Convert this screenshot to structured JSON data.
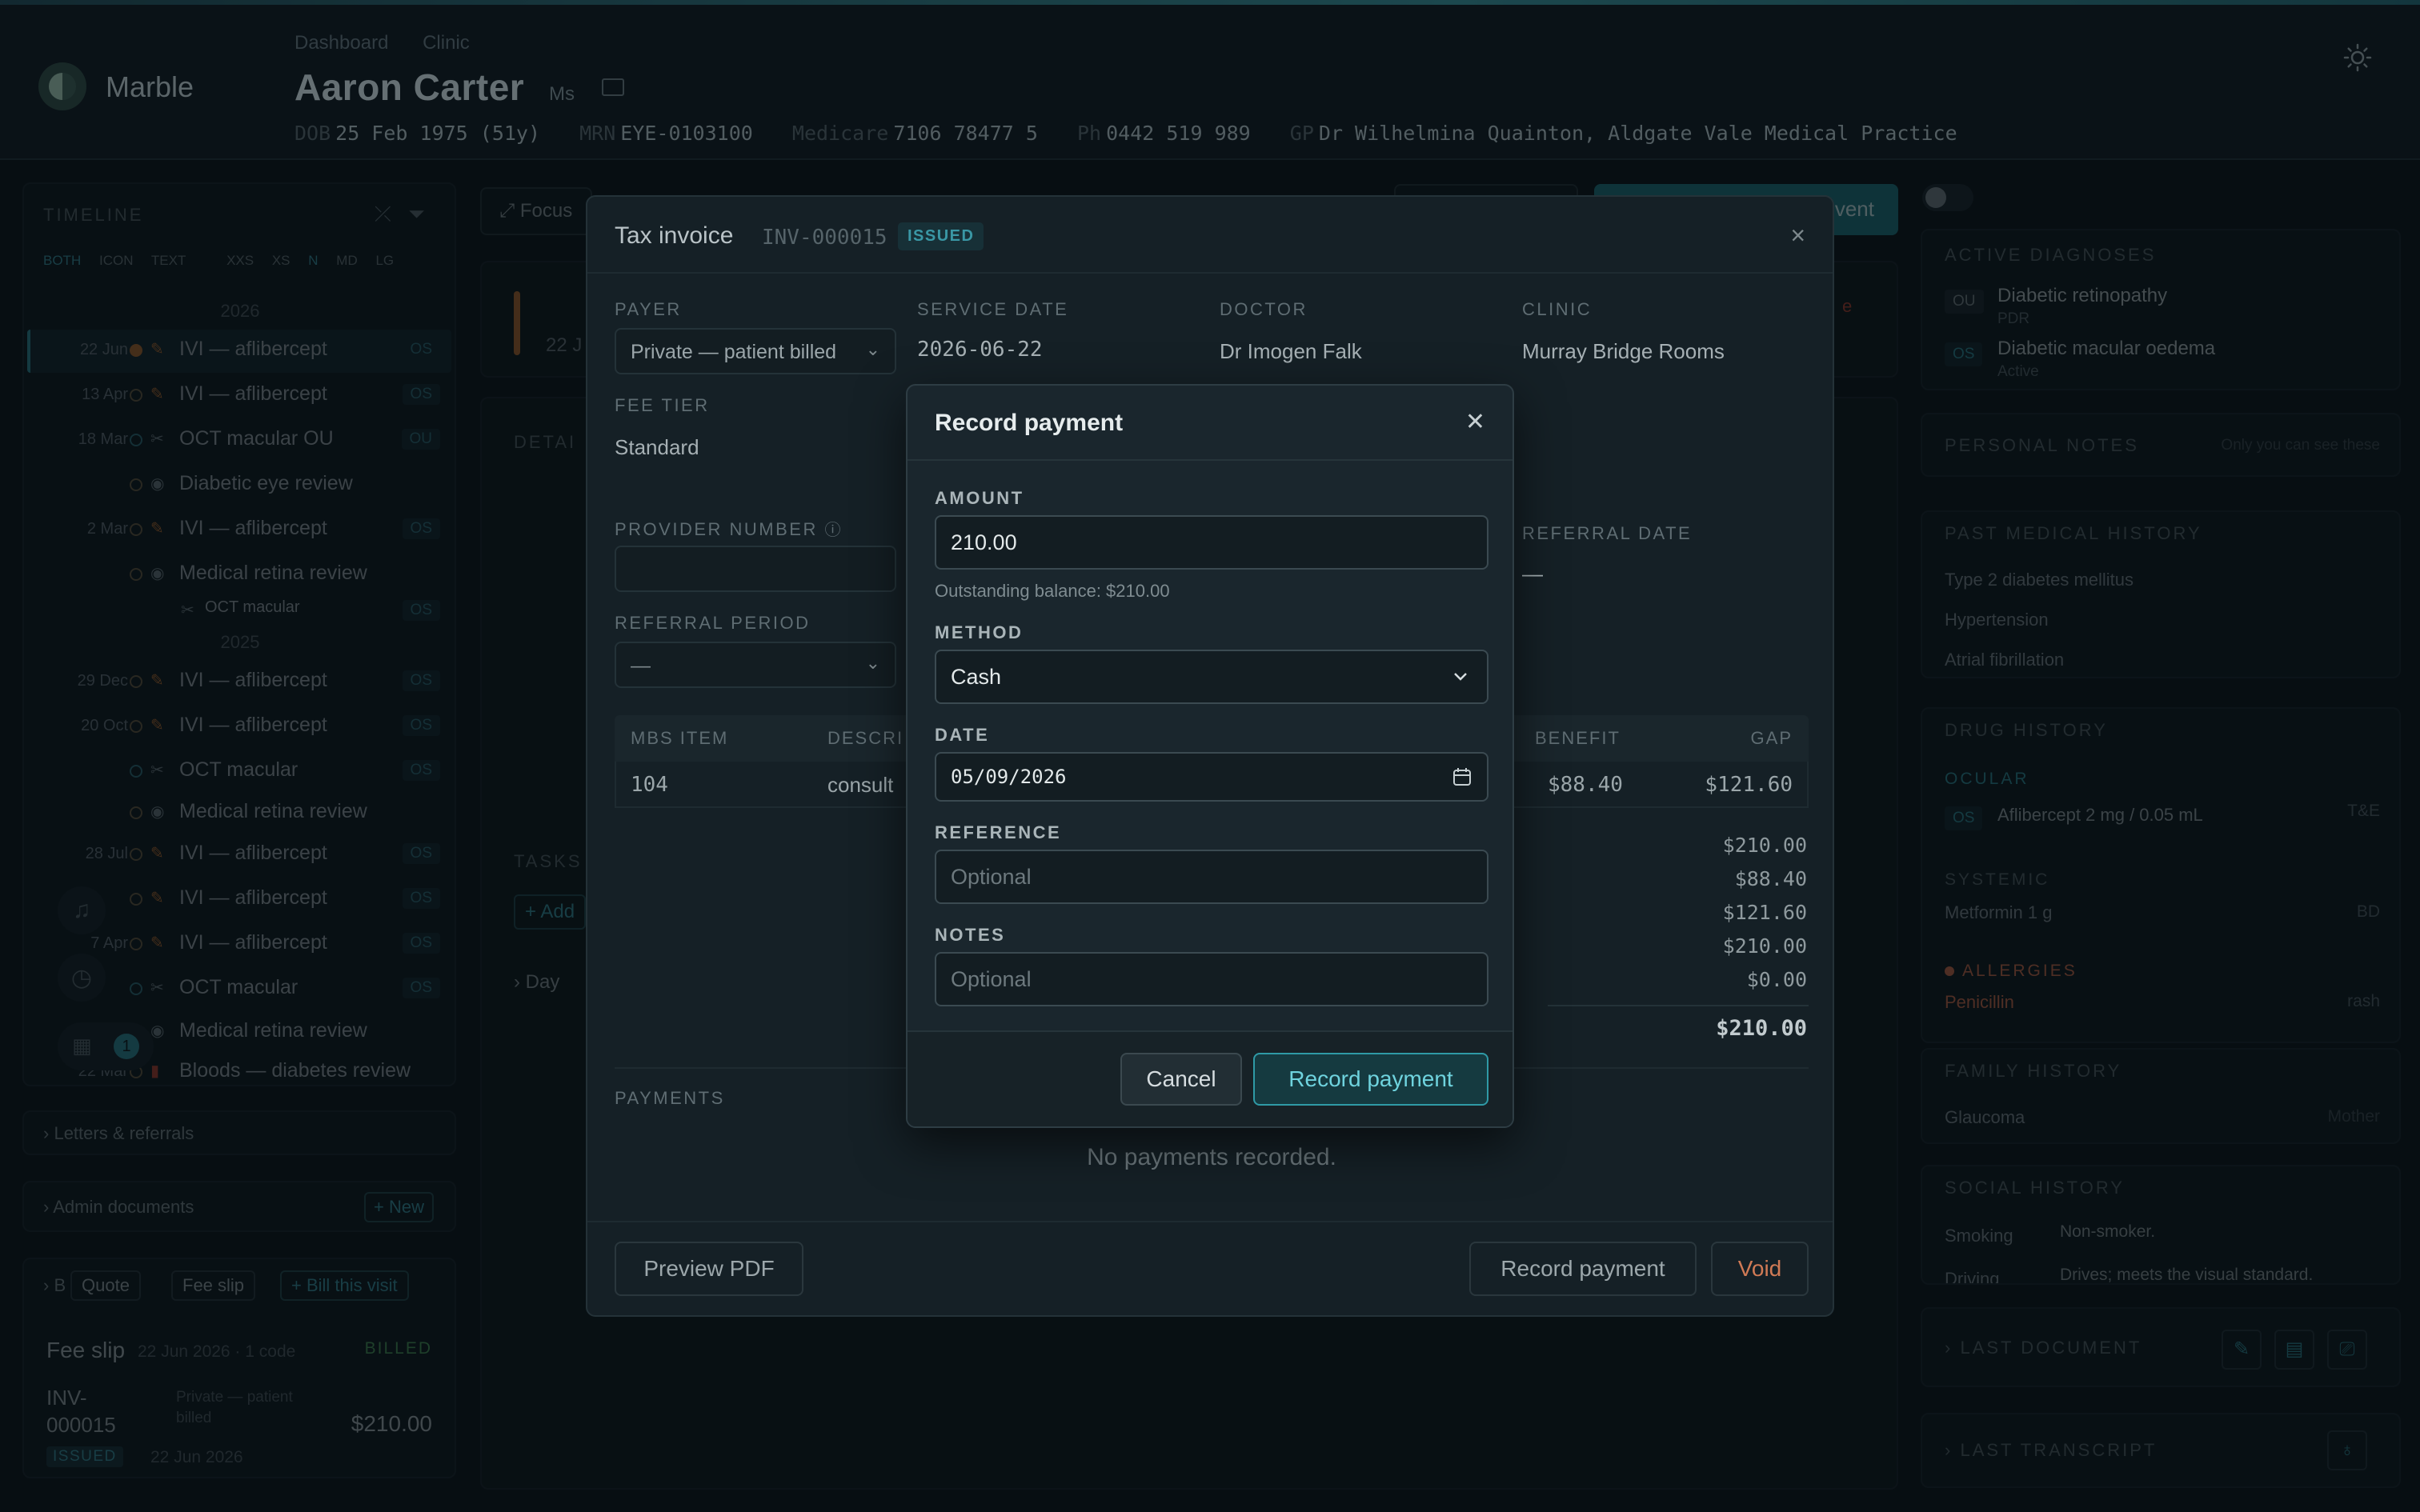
{
  "app": {
    "brand": "Marble"
  },
  "header": {
    "breadcrumbs": [
      "Dashboard",
      "Clinic"
    ],
    "patient_name": "Aaron Carter",
    "patient_title": "Ms",
    "dob_label": "DOB",
    "dob": "25 Feb 1975 (51y)",
    "mrn_label": "MRN",
    "mrn": "EYE-0103100",
    "medicare_label": "Medicare",
    "medicare": "7106 78477 5",
    "ph_label": "Ph",
    "phone": "0442 519 989",
    "gp_label": "GP",
    "gp": "Dr Wilhelmina Quainton, Aldgate Vale Medical Practice"
  },
  "timeline": {
    "title": "TIMELINE",
    "view_tabs": [
      "BOTH",
      "ICON",
      "TEXT"
    ],
    "size_tabs": [
      "XXS",
      "XS",
      "N",
      "MD",
      "LG"
    ],
    "year_2026": "2026",
    "year_2025": "2025",
    "items": [
      {
        "date": "22 Jun",
        "label": "IVI — aflibercept",
        "eye": "OS"
      },
      {
        "date": "13 Apr",
        "label": "IVI — aflibercept",
        "eye": "OS"
      },
      {
        "date": "18 Mar",
        "label": "OCT macular OU",
        "eye": "OU"
      },
      {
        "date": "",
        "label": "Diabetic eye review",
        "eye": ""
      },
      {
        "date": "2 Mar",
        "label": "IVI — aflibercept",
        "eye": "OS"
      },
      {
        "date": "",
        "label": "Medical retina review",
        "eye": ""
      },
      {
        "date": "",
        "label": "OCT macular",
        "eye": "OS"
      },
      {
        "date": "29 Dec",
        "label": "IVI — aflibercept",
        "eye": "OS"
      },
      {
        "date": "20 Oct",
        "label": "IVI — aflibercept",
        "eye": "OS"
      },
      {
        "date": "",
        "label": "OCT macular",
        "eye": "OS"
      },
      {
        "date": "",
        "label": "Medical retina review",
        "eye": ""
      },
      {
        "date": "28 Jul",
        "label": "IVI — aflibercept",
        "eye": "OS"
      },
      {
        "date": "",
        "label": "IVI — aflibercept",
        "eye": "OS"
      },
      {
        "date": "7 Apr",
        "label": "IVI — aflibercept",
        "eye": "OS"
      },
      {
        "date": "",
        "label": "OCT macular",
        "eye": "OS"
      },
      {
        "date": "",
        "label": "Medical retina review",
        "eye": ""
      },
      {
        "date": "22 Mar",
        "label": "Bloods — diabetes review",
        "eye": ""
      }
    ],
    "notif_count": "1"
  },
  "left_sections": {
    "letters": "Letters & referrals",
    "admin": "Admin documents",
    "new_btn": "+ New",
    "quote_btn": "Quote",
    "fee_slip_btn": "Fee slip",
    "bill_btn": "+ Bill this visit",
    "fee_slip_title": "Fee slip",
    "fee_slip_meta": "22 Jun 2026 · 1 code",
    "fee_slip_status": "BILLED",
    "inv_no": "INV-000015",
    "inv_payer": "Private — patient billed",
    "inv_amount": "$210.00",
    "inv_status": "ISSUED",
    "inv_date": "22 Jun 2026"
  },
  "center_bg": {
    "focus": "Focus",
    "record_event_btn": "vent",
    "details": "DETAI",
    "tasks": "TASKS",
    "add": "+ Add",
    "day": "Day"
  },
  "right_panel": {
    "active_dx_title": "ACTIVE DIAGNOSES",
    "dx": [
      {
        "eye": "OU",
        "name": "Diabetic retinopathy",
        "sub": "PDR"
      },
      {
        "eye": "OS",
        "name": "Diabetic macular oedema",
        "sub": "Active"
      }
    ],
    "personal_notes_title": "PERSONAL NOTES",
    "personal_notes_hint": "Only you can see these",
    "pmh_title": "PAST MEDICAL HISTORY",
    "pmh": [
      "Type 2 diabetes mellitus",
      "Hypertension",
      "Atrial fibrillation"
    ],
    "drug_title": "DRUG HISTORY",
    "ocular_label": "OCULAR",
    "ocular_drug_eye": "OS",
    "ocular_drug": "Aflibercept 2 mg / 0.05 mL",
    "ocular_drug_freq": "T&E",
    "systemic_label": "SYSTEMIC",
    "systemic_drug": "Metformin 1 g",
    "systemic_freq": "BD",
    "allergies_label": "ALLERGIES",
    "allergy": "Penicillin",
    "allergy_reaction": "rash",
    "family_title": "FAMILY HISTORY",
    "family_item": "Glaucoma",
    "family_rel": "Mother",
    "social_title": "SOCIAL HISTORY",
    "smoking_label": "Smoking",
    "smoking_val": "Non-smoker.",
    "driving_label": "Driving",
    "driving_val": "Drives; meets the visual standard.",
    "last_doc": "LAST DOCUMENT",
    "last_transcript": "LAST TRANSCRIPT"
  },
  "invoice": {
    "title": "Tax invoice",
    "number": "INV-000015",
    "status": "ISSUED",
    "payer_label": "PAYER",
    "payer_value": "Private — patient billed",
    "service_date_label": "SERVICE DATE",
    "service_date": "2026-06-22",
    "doctor_label": "DOCTOR",
    "doctor": "Dr Imogen Falk",
    "clinic_label": "CLINIC",
    "clinic": "Murray Bridge Rooms",
    "fee_tier_label": "FEE TIER",
    "fee_tier": "Standard",
    "provider_label": "PROVIDER NUMBER",
    "referral_date_label": "REFERRAL DATE",
    "referral_date": "—",
    "referral_period_label": "REFERRAL PERIOD",
    "referral_period": "—",
    "table_headers": {
      "mbs": "MBS ITEM",
      "desc": "DESCRI",
      "benefit": "BENEFIT",
      "gap": "GAP"
    },
    "row": {
      "mbs": "104",
      "desc": "consult",
      "benefit": "$88.40",
      "gap": "$121.60"
    },
    "totals": [
      "$210.00",
      "$88.40",
      "$121.60",
      "$210.00",
      "$0.00"
    ],
    "grand_total": "$210.00",
    "payments_label": "PAYMENTS",
    "no_payments": "No payments recorded.",
    "preview_pdf": "Preview PDF",
    "record_payment": "Record payment",
    "void": "Void"
  },
  "payment_dialog": {
    "title": "Record payment",
    "amount_label": "AMOUNT",
    "amount": "210.00",
    "outstanding": "Outstanding balance: $210.00",
    "method_label": "METHOD",
    "method": "Cash",
    "date_label": "DATE",
    "date": "05/09/2026",
    "reference_label": "REFERENCE",
    "reference_placeholder": "Optional",
    "notes_label": "NOTES",
    "notes_placeholder": "Optional",
    "cancel": "Cancel",
    "submit": "Record payment"
  },
  "colors": {
    "accent": "#2f9aa6",
    "warn": "#b56b2e",
    "bg": "#0a1116"
  }
}
